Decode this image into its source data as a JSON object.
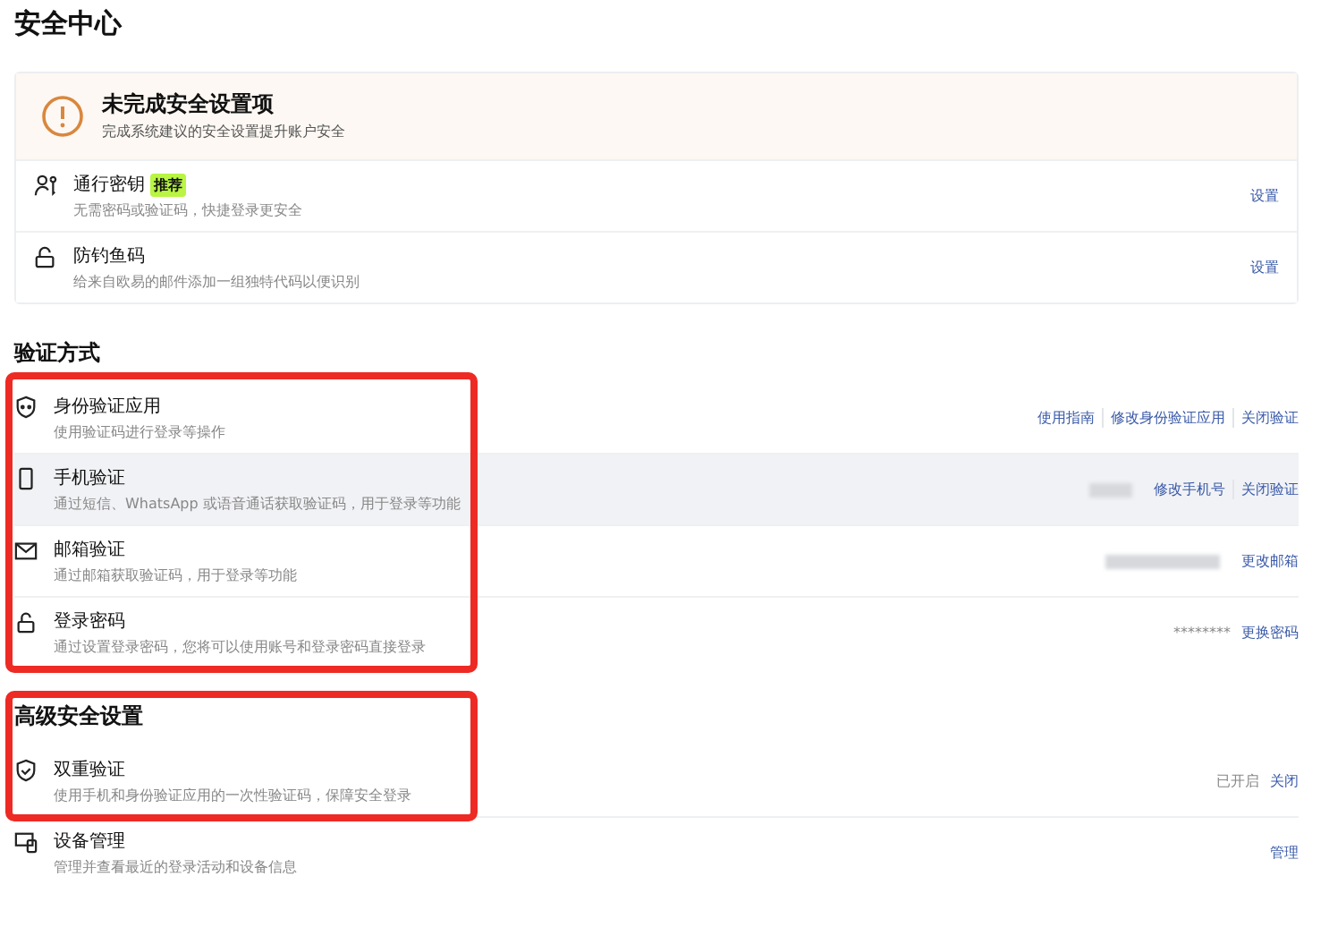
{
  "page_title": "安全中心",
  "alert": {
    "title": "未完成安全设置项",
    "description": "完成系统建议的安全设置提升账户安全"
  },
  "pending_items": [
    {
      "title": "通行密钥",
      "badge": "推荐",
      "description": "无需密码或验证码，快捷登录更安全",
      "actions": [
        "设置"
      ]
    },
    {
      "title": "防钓鱼码",
      "description": "给来自欧易的邮件添加一组独特代码以便识别",
      "actions": [
        "设置"
      ]
    }
  ],
  "sections": [
    {
      "title": "验证方式",
      "title_highlighted": false,
      "rows": [
        {
          "title": "身份验证应用",
          "description": "使用验证码进行登录等操作",
          "shaded": false,
          "highlighted": true,
          "blurred_value": false,
          "actions": [
            "使用指南",
            "修改身份验证应用",
            "关闭验证"
          ]
        },
        {
          "title": "手机验证",
          "description": "通过短信、WhatsApp 或语音通话获取验证码，用于登录等功能",
          "shaded": true,
          "highlighted": true,
          "blurred_value": true,
          "actions": [
            "修改手机号",
            "关闭验证"
          ]
        },
        {
          "title": "邮箱验证",
          "description": "通过邮箱获取验证码，用于登录等功能",
          "shaded": false,
          "highlighted": true,
          "blurred_value": true,
          "actions": [
            "更改邮箱"
          ]
        },
        {
          "title": "登录密码",
          "description": "通过设置登录密码，您将可以使用账号和登录密码直接登录",
          "shaded": false,
          "highlighted": true,
          "blurred_value": false,
          "value": "********",
          "actions": [
            "更换密码"
          ]
        }
      ]
    },
    {
      "title": "高级安全设置",
      "title_highlighted": true,
      "rows": [
        {
          "title": "双重验证",
          "description": "使用手机和身份验证应用的一次性验证码，保障安全登录",
          "shaded": false,
          "highlighted": true,
          "blurred_value": false,
          "value": "已开启",
          "actions": [
            "关闭"
          ]
        },
        {
          "title": "设备管理",
          "description": "管理并查看最近的登录活动和设备信息",
          "shaded": false,
          "highlighted": false,
          "blurred_value": false,
          "actions": [
            "管理"
          ]
        }
      ]
    }
  ]
}
